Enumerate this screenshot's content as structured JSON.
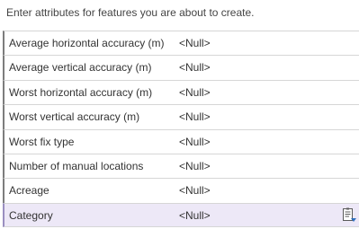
{
  "instruction": "Enter attributes for features you are about to create.",
  "attributes": [
    {
      "label": "Average horizontal accuracy (m)",
      "value": "<Null>"
    },
    {
      "label": "Average vertical accuracy (m)",
      "value": "<Null>"
    },
    {
      "label": "Worst horizontal accuracy (m)",
      "value": "<Null>"
    },
    {
      "label": "Worst vertical accuracy (m)",
      "value": "<Null>"
    },
    {
      "label": "Worst fix type",
      "value": "<Null>"
    },
    {
      "label": "Number of manual locations",
      "value": "<Null>"
    },
    {
      "label": "Acreage",
      "value": "<Null>"
    },
    {
      "label": "Category",
      "value": "<Null>",
      "selected": true,
      "icon": "list-dropdown-icon"
    }
  ]
}
